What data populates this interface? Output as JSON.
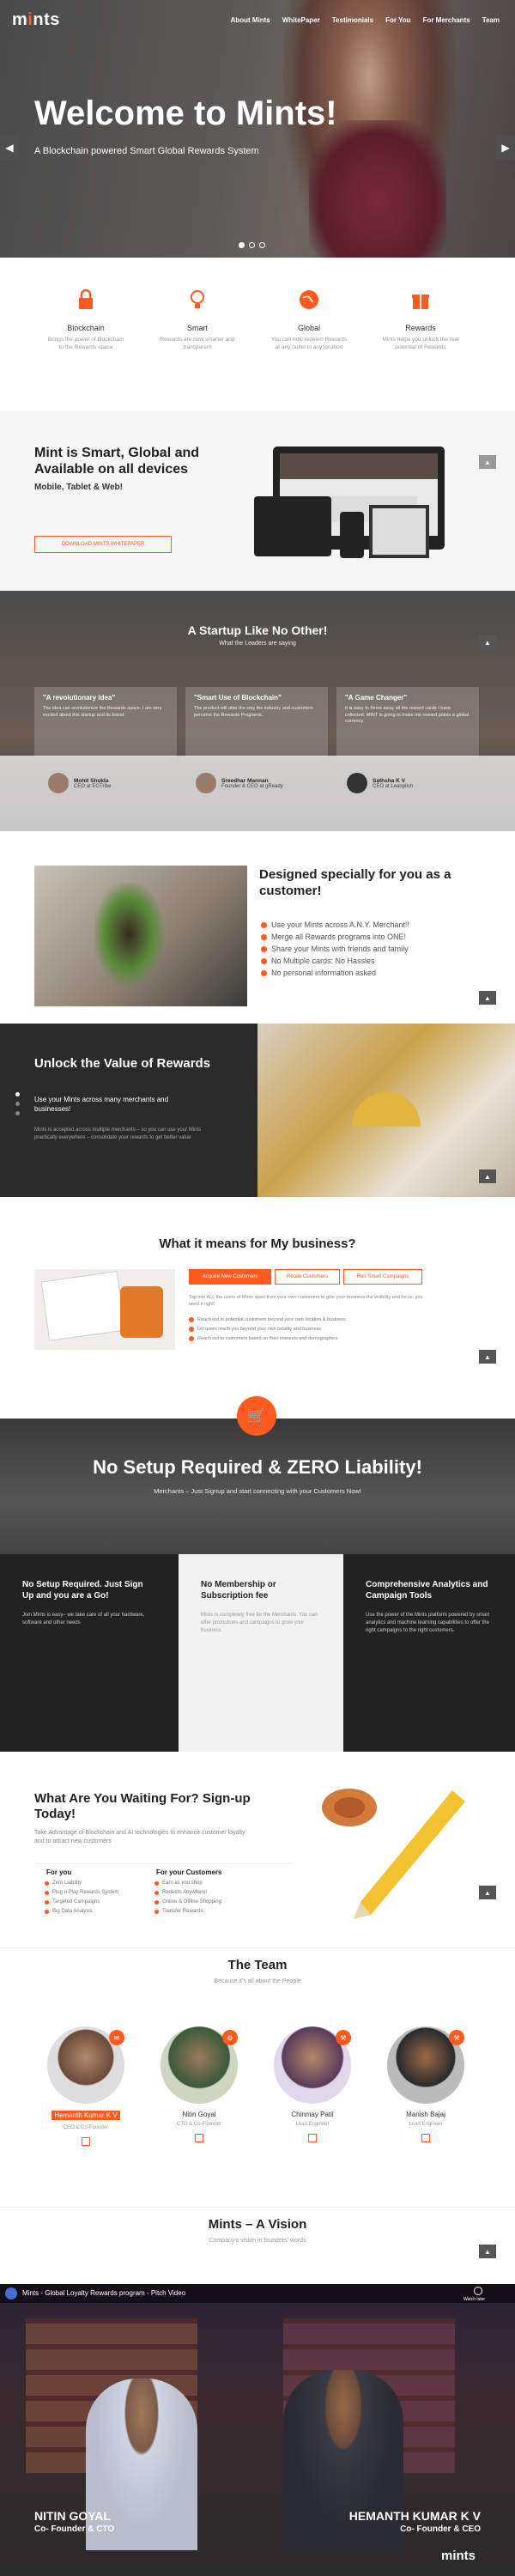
{
  "nav": {
    "logo_text": "m",
    "logo_dot": "i",
    "logo_rest": "nts",
    "links": [
      "About Mints",
      "WhitePaper",
      "Testimonials",
      "For You",
      "For Merchants",
      "Team"
    ]
  },
  "hero": {
    "title": "Welcome to Mints!",
    "subtitle": "A Blockchain powered Smart Global Rewards System",
    "prev_icon": "chevron-left-icon",
    "next_icon": "chevron-right-icon"
  },
  "features": [
    {
      "title": "Blockchain",
      "desc": "Brings the power of blockchain to the Rewards space",
      "icon": "lock-icon"
    },
    {
      "title": "Smart",
      "desc": "Rewards are now smarter and transparent",
      "icon": "lightbulb-icon"
    },
    {
      "title": "Global",
      "desc": "You can now redeem Rewards at any outlet in any location",
      "icon": "globe-icon"
    },
    {
      "title": "Rewards",
      "desc": "Mints helps you unlock the real potential of Rewards",
      "icon": "gift-icon"
    }
  ],
  "devices": {
    "title": "Mint is Smart, Global and Available on all devices",
    "subtitle": "Mobile, Tablet & Web!",
    "button": "DOWNLOAD MINTS WHITEPAPER"
  },
  "startup": {
    "title": "A Startup Like No Other!",
    "subtitle": "What the Leaders are saying",
    "quotes": [
      {
        "title": "\"A revolutionary Idea\"",
        "text": "The idea can revolutionize the Rewards space. I am very excited about this startup and its brand"
      },
      {
        "title": "\"Smart Use of Blockchain\"",
        "text": "The product will alter the way the industry and customers perceive the Rewards Programs."
      },
      {
        "title": "\"A Game Changer\"",
        "text": "It is easy to throw away all the reward cards I have collected. MINT is going to make me reward points a global currency."
      }
    ],
    "people": [
      {
        "name": "Mohit Shukla",
        "role": "CEO at EGTribe"
      },
      {
        "name": "Sreedhar Mannan",
        "role": "Founder & CEO at gReady"
      },
      {
        "name": "Sathsha K V",
        "role": "CEO at Leanpitch"
      }
    ]
  },
  "designed": {
    "title": "Designed specially for you as a customer!",
    "items": [
      "Use your Mints across A.N.Y. Merchant!!",
      "Merge all Rewards programs into ONE!",
      "Share your Mints with friends and family",
      "No Multiple cards: No Hassles",
      "No personal information asked"
    ]
  },
  "unlock": {
    "title": "Unlock the Value of Rewards",
    "subtitle": "Use your Mints across many merchants and businesses!",
    "text": "Mints is accepted across multiple merchants – so you can use your Mints practically everywhere – consolidate your rewards to get better value"
  },
  "business": {
    "title": "What it means for My business?",
    "tabs": [
      "Acquire New Customers",
      "Retain Customers",
      "Run Smart Campaigns"
    ],
    "intro": "Tap into ALL the users of Mints apart from your own customers to give your business the visibility and focus, you need it right!",
    "bullets": [
      "Reach out to potential customers beyond your own location & business",
      "Let users reach you beyond your own locality and business",
      "Reach out to customers based on their interests and demographics"
    ]
  },
  "nosetup": {
    "title": "No Setup Required & ZERO Liability!",
    "subtitle": "Merchants – Just Signup and start connecting with your Customers Now!",
    "icon": "cart-icon",
    "cols": [
      {
        "title": "No Setup Required. Just Sign Up and you are a Go!",
        "text": "Join Mints is easy– we take care of all your hardware, software and other needs"
      },
      {
        "title": "No Membership or Subscription fee",
        "text": "Mints is completely free for the Merchants. You can offer promotions and campaigns to grow your business"
      },
      {
        "title": "Comprehensive Analytics and Campaign Tools",
        "text": "Use the power of the Mints platform powered by smart analytics and machine learning capabilities to offer the right campaigns to the right customers."
      }
    ]
  },
  "waiting": {
    "title": "What Are You Waiting For? Sign-up Today!",
    "text": "Take Advantage of Blockchain and AI technologies to enhance customer loyalty and to attract new customers",
    "you_title": "For you",
    "you": [
      "Zero Liability",
      "Plug n Play Rewards System",
      "Targeted Campaigns",
      "Big Data Analysis"
    ],
    "cust_title": "For your Customers",
    "cust": [
      "Earn as you shop",
      "Redeem Anywhere!",
      "Online & Offline Shopping",
      "Transfer Rewards"
    ]
  },
  "team": {
    "title": "The Team",
    "subtitle": "Because it's all about the People",
    "members": [
      {
        "name": "Hemanth Kumar K V",
        "role": "CEO & Co-Founder",
        "icon": "mail-icon"
      },
      {
        "name": "Nitin Goyal",
        "role": "CTO & Co-Founder",
        "icon": "gear-icon"
      },
      {
        "name": "Chinmay Patil",
        "role": "Lead Engineer",
        "icon": "wrench-icon"
      },
      {
        "name": "Manish Bajaj",
        "role": "Lead Engineer",
        "icon": "wrench-icon"
      }
    ]
  },
  "vision": {
    "title": "Mints – A Vision",
    "subtitle": "Company's vision in founders' words"
  },
  "video": {
    "title": "Mints - Global Loyalty Rewards program - Pitch Video",
    "watch_later": "Watch later",
    "left_name": "NITIN GOYAL",
    "left_role": "Co- Founder & CTO",
    "right_name": "HEMANTH KUMAR K V",
    "right_role": "Co- Founder & CEO",
    "logo": "mints"
  },
  "colors": {
    "accent": "#ff5a1f",
    "dark": "#222222"
  }
}
